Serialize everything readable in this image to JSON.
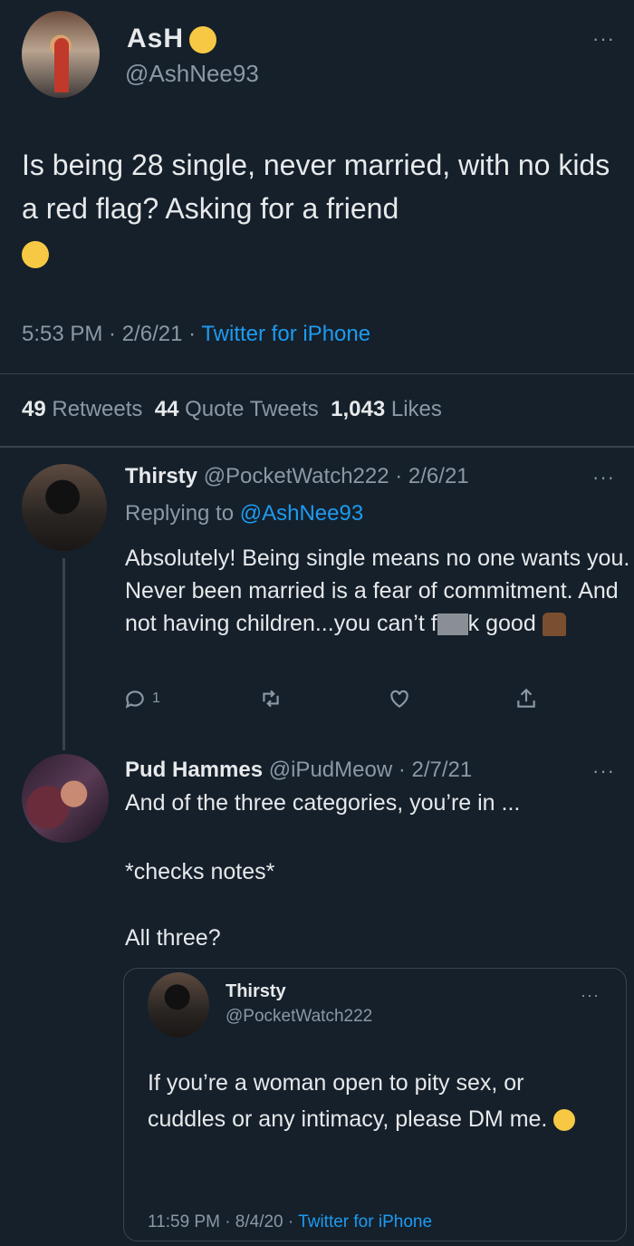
{
  "main_tweet": {
    "name": "AsH",
    "handle": "@AshNee93",
    "text": "Is being 28 single, never married, with no kids a red flag? Asking for a friend",
    "time_date": "5:53 PM · 2/6/21 · ",
    "source": "Twitter for iPhone",
    "stats": {
      "retweets_count": "49",
      "retweets_label": "Retweets",
      "quotes_count": "44",
      "quotes_label": "Quote Tweets",
      "likes_count": "1,043",
      "likes_label": "Likes"
    },
    "more": "···"
  },
  "reply_1": {
    "name": "Thirsty",
    "handle_date": "@PocketWatch222 · 2/6/21",
    "replying_prefix": "Replying to ",
    "replying_handle": "@AshNee93",
    "text_main": "Absolutely! Being single means no one wants you. Never been married is a fear of commitment. And not having children...you can’t f",
    "text_tail": "k good",
    "reply_count": "1",
    "more": "···"
  },
  "reply_2": {
    "name": "Pud Hammes",
    "handle_date": "@iPudMeow · 2/7/21",
    "line1": "And of the three categories, you’re in ...",
    "line2": "*checks notes*",
    "line3": "All three?",
    "more": "···"
  },
  "quoted_tweet": {
    "name": "Thirsty",
    "handle": "@PocketWatch222",
    "text": "If you’re a woman open to pity sex, or cuddles or any intimacy, please DM me.",
    "time_date": "11:59 PM · 8/4/20 · ",
    "source": "Twitter for iPhone",
    "more": "···"
  },
  "colors": {
    "background": "#15202b",
    "text": "#e7e9ea",
    "muted": "#8b98a5",
    "link": "#1d9bf0",
    "divider": "#38444d"
  }
}
